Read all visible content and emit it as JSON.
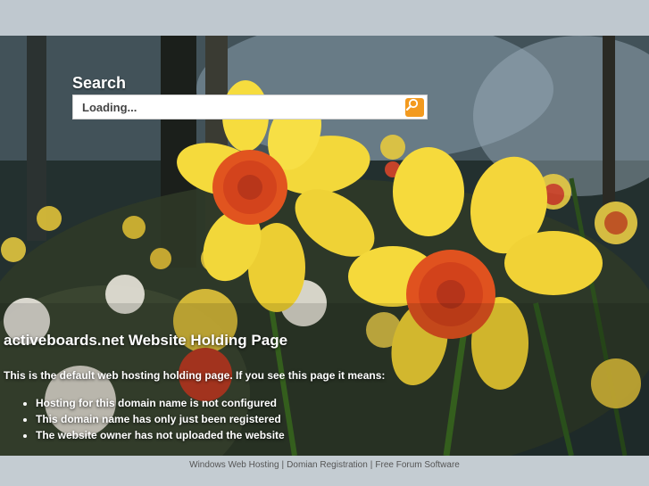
{
  "search": {
    "title": "Search",
    "placeholder": "Loading..."
  },
  "holding": {
    "heading": "activeboards.net Website Holding Page",
    "intro": "This is the default web hosting holding page. If you see this page it means:",
    "reasons": [
      "Hosting for this domain name is not configured",
      "This domain name has only just been registered",
      "The website owner has not uploaded the website"
    ]
  },
  "footer": {
    "links": [
      "Windows Web Hosting",
      "Domian Registration",
      "Free Forum Software"
    ],
    "separator": "|"
  },
  "colors": {
    "search_button": "#f39a1e",
    "top_band": "#bfc8cf",
    "footer_bg": "#c4ccd2"
  },
  "icons": {
    "search_button": "magnifier-icon"
  }
}
